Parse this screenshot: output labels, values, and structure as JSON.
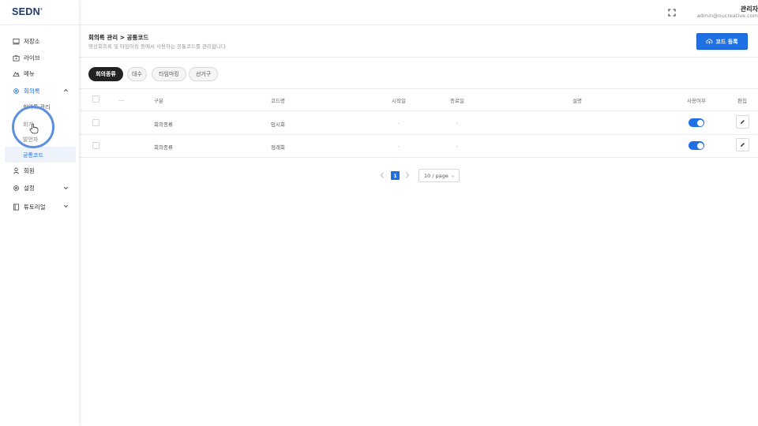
{
  "brand": {
    "logo": "SEDN",
    "mark": "®"
  },
  "header": {
    "user_name": "관리자",
    "user_email": "admin@nucreative.com"
  },
  "sidebar": {
    "items": [
      {
        "label": "저장소",
        "icon": "storage-icon"
      },
      {
        "label": "라이브",
        "icon": "live-icon"
      },
      {
        "label": "메뉴",
        "icon": "menu-icon"
      },
      {
        "label": "회의록",
        "icon": "gear-icon"
      },
      {
        "label": "회원",
        "icon": "user-icon"
      },
      {
        "label": "설정",
        "icon": "gear-icon"
      },
      {
        "label": "튜토리얼",
        "icon": "book-icon"
      }
    ],
    "sub_items": [
      {
        "label": "회의록 관리"
      },
      {
        "label": "회기"
      },
      {
        "label": "발언자"
      },
      {
        "label": "공통코드"
      }
    ]
  },
  "page": {
    "title": "회의록 관리 > 공통코드",
    "description": "영상회의록 및 타임머킹 등에서 사용하는 공통코드를 관리합니다",
    "add_button": "코드 등록"
  },
  "tabs": [
    {
      "label": "회의종류",
      "active": true
    },
    {
      "label": "대수",
      "active": false
    },
    {
      "label": "타임마킹",
      "active": false
    },
    {
      "label": "선거구",
      "active": false
    }
  ],
  "table": {
    "headers": [
      "...",
      "구분",
      "코드명",
      "시작일",
      "종료일",
      "설명",
      "사용여부",
      "편집"
    ],
    "rows": [
      {
        "category": "회의종류",
        "code_name": "임시회",
        "start": "-",
        "end": "-",
        "desc": "",
        "enabled": true
      },
      {
        "category": "회의종류",
        "code_name": "정례회",
        "start": "-",
        "end": "-",
        "desc": "",
        "enabled": true
      }
    ]
  },
  "pagination": {
    "current": "1",
    "page_size": "10 / page"
  },
  "colors": {
    "accent": "#1f6fe5",
    "brand": "#1f3a6b",
    "tab_active": "#222222"
  }
}
